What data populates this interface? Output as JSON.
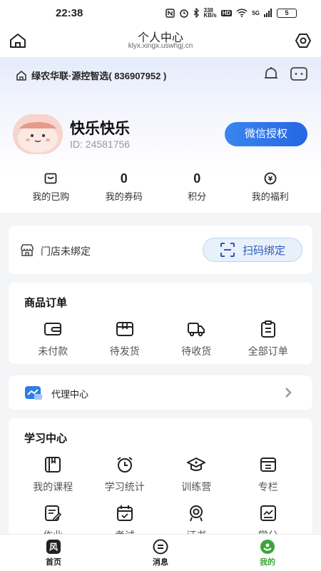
{
  "status_bar": {
    "time": "22:38",
    "net_speed_top": "338",
    "net_speed_bottom": "KB/s",
    "hd": "HD",
    "signal": "5G",
    "battery": "5"
  },
  "header": {
    "title": "个人中心",
    "subtitle": "klyx.xingx.uswhgj.cn"
  },
  "store": {
    "name": "绿农华联·源控智选( 836907952 )"
  },
  "profile": {
    "username": "快乐快乐",
    "user_id": "ID: 24581756",
    "wechat_button": "微信授权"
  },
  "stats": [
    {
      "value": "",
      "label": "我的已购"
    },
    {
      "value": "0",
      "label": "我的券码"
    },
    {
      "value": "0",
      "label": "积分"
    },
    {
      "value": "",
      "label": "我的福利"
    }
  ],
  "store_binding": {
    "status": "门店未绑定",
    "scan_button": "扫码绑定"
  },
  "orders": {
    "title": "商品订单",
    "items": [
      {
        "label": "未付款"
      },
      {
        "label": "待发货"
      },
      {
        "label": "待收货"
      },
      {
        "label": "全部订单"
      }
    ]
  },
  "agent": {
    "label": "代理中心"
  },
  "learning": {
    "title": "学习中心",
    "row1": [
      {
        "label": "我的课程"
      },
      {
        "label": "学习统计"
      },
      {
        "label": "训练营"
      },
      {
        "label": "专栏"
      }
    ],
    "row2": [
      {
        "label": "作业"
      },
      {
        "label": "考试"
      },
      {
        "label": "证书"
      },
      {
        "label": "学分"
      }
    ]
  },
  "tabbar": {
    "items": [
      {
        "label": "首页",
        "icon": "风"
      },
      {
        "label": "消息"
      },
      {
        "label": "我的"
      }
    ],
    "active_color": "#3aa63a"
  },
  "colors": {
    "accent": "#2566e3"
  }
}
